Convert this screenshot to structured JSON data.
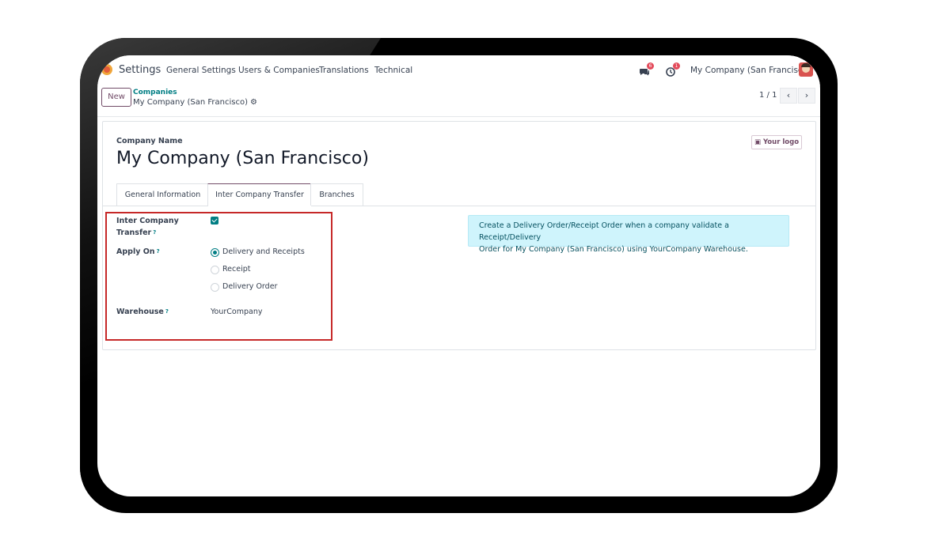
{
  "navbar": {
    "app_name": "Settings",
    "menus": [
      "General Settings",
      "Users & Companies",
      "Translations",
      "Technical"
    ],
    "messages_badge": "6",
    "activities_badge": "1",
    "company": "My Company (San Francisco)"
  },
  "control_panel": {
    "new_label": "New",
    "breadcrumb_parent": "Companies",
    "breadcrumb_current": "My Company (San Francisco)",
    "pager": "1 / 1"
  },
  "form": {
    "company_name_label": "Company Name",
    "company_name": "My Company (San Francisco)",
    "logo_button": "Your logo",
    "tabs": [
      "General Information",
      "Inter Company Transfer",
      "Branches"
    ],
    "active_tab": "Inter Company Transfer",
    "inter_company_label_line1": "Inter Company",
    "inter_company_label_line2": "Transfer",
    "inter_company_checked": true,
    "apply_on_label": "Apply On",
    "apply_on_options": [
      "Delivery and Receipts",
      "Receipt",
      "Delivery Order"
    ],
    "apply_on_selected": "Delivery and Receipts",
    "warehouse_label": "Warehouse",
    "warehouse_value": "YourCompany",
    "help_mark": "?",
    "info_line1": "Create a Delivery Order/Receipt Order when a company validate a Receipt/Delivery",
    "info_line2": "Order for My Company (San Francisco) using YourCompany Warehouse."
  },
  "colors": {
    "primary": "#714B67",
    "teal": "#017e84",
    "highlight_border": "#c62828",
    "info_bg": "#cff4fc"
  }
}
